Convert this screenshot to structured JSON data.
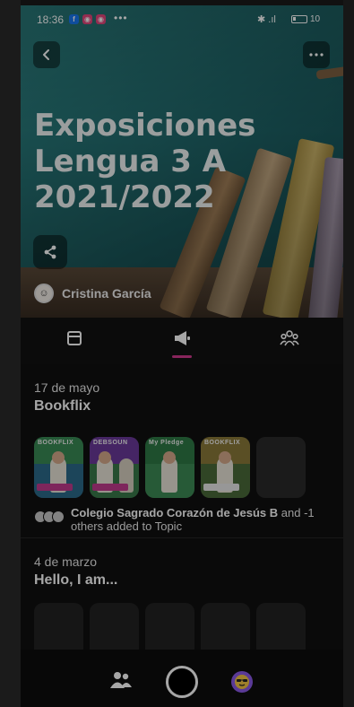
{
  "status_bar": {
    "time": "18:36",
    "dots": "•••",
    "signal": "✱ .ıl",
    "battery_pct": "10"
  },
  "hero": {
    "title": "Exposiciones Lengua 3 A 2021/2022",
    "author": "Cristina García",
    "back_icon": "chevron-left-icon",
    "more_icon": "more-dots-icon",
    "share_icon": "share-icon"
  },
  "tabs": [
    {
      "icon": "layout-icon"
    },
    {
      "icon": "megaphone-icon",
      "active": true
    },
    {
      "icon": "group-icon"
    }
  ],
  "feed": [
    {
      "date": "17 de mayo",
      "topic": "Bookflix",
      "thumb_labels": [
        "BOOKFLIX",
        "DEBSOUN",
        "My Pledge",
        "BOOKFLIX"
      ],
      "added_by": "Colegio Sagrado Corazón de Jesús B",
      "added_rest": " and -1 others added to Topic"
    },
    {
      "date": "4 de marzo",
      "topic": "Hello, I am..."
    }
  ],
  "colors": {
    "accent": "#d13a8e",
    "hero_teal": "#236f72",
    "avatar_purple": "#8b59e8"
  }
}
